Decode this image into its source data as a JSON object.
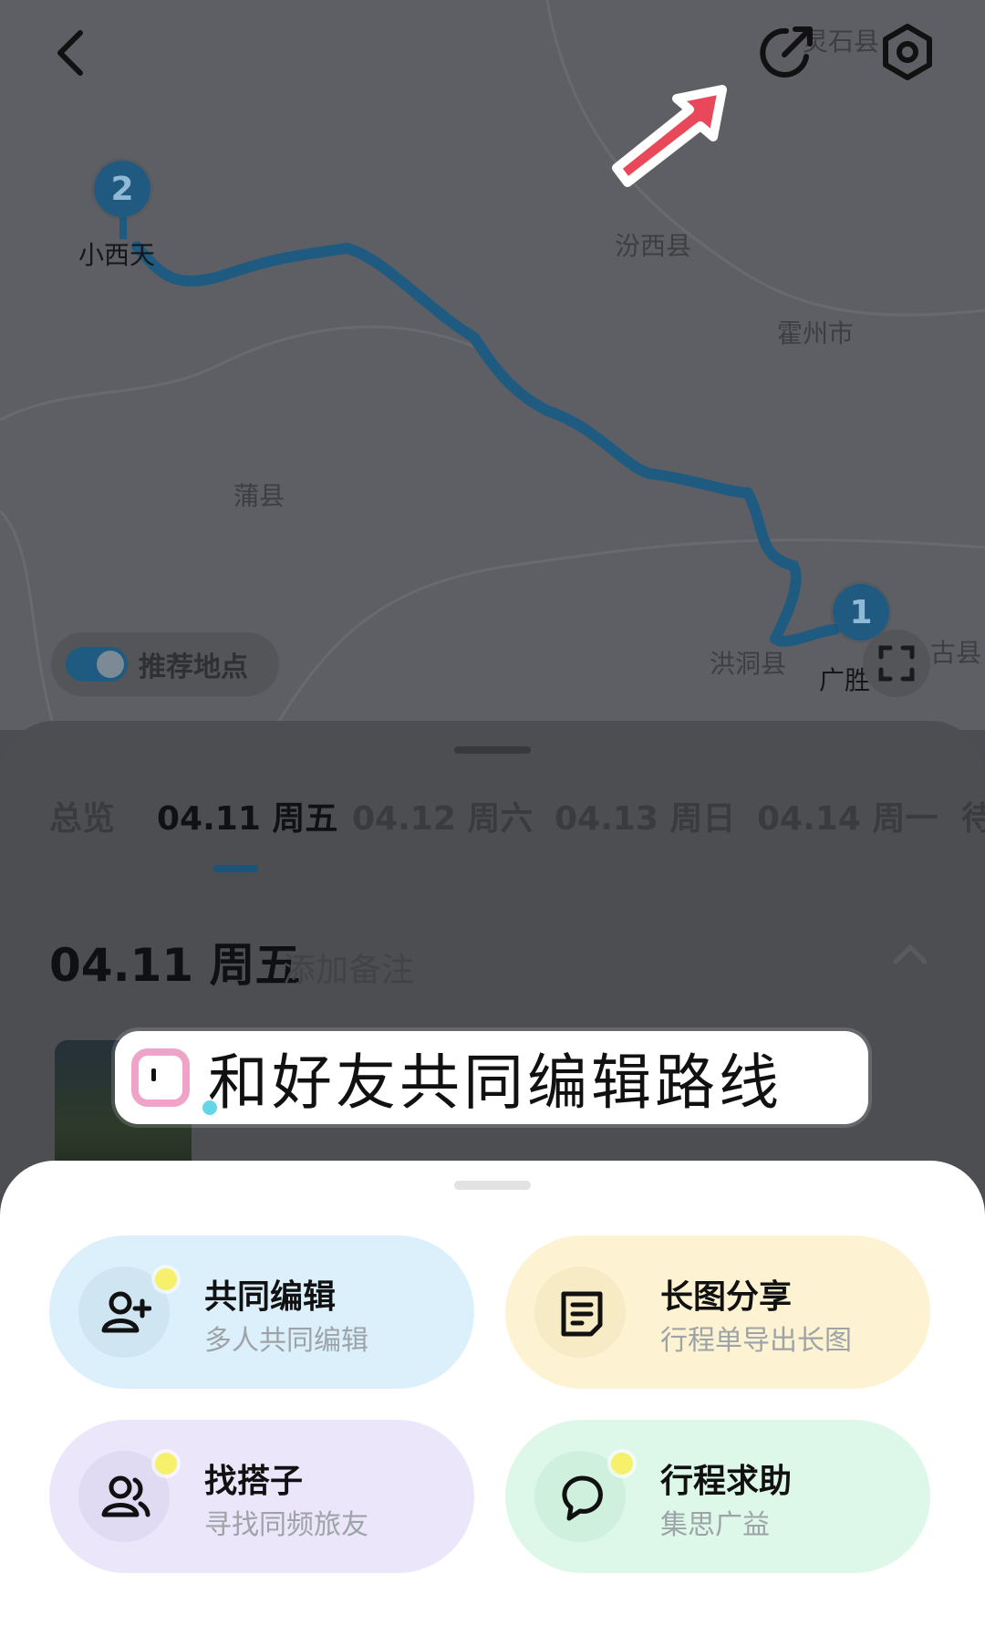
{
  "map": {
    "places": {
      "xiaoxitian": "小西天",
      "fenxi": "汾西县",
      "huozhou": "霍州市",
      "puxian": "蒲县",
      "hongtong": "洪洞县",
      "lingshi": "灵石县",
      "gu": "古县",
      "guang": "广胜"
    },
    "markers": {
      "start": "1",
      "end": "2"
    },
    "recommend_label": "推荐地点",
    "route_color": "#1f5b81"
  },
  "tabs": [
    {
      "label": "总览"
    },
    {
      "label": "04.11 周五"
    },
    {
      "label": "04.12 周六"
    },
    {
      "label": "04.13 周日"
    },
    {
      "label": "04.14 周一"
    },
    {
      "label": "待"
    }
  ],
  "day": {
    "title": "04.11 周五",
    "add_note": "添加备注"
  },
  "caption": {
    "text": "和好友共同编辑路线"
  },
  "actions": [
    {
      "title": "共同编辑",
      "subtitle": "多人共同编辑",
      "icon": "add-user-icon",
      "bg": "#dbf0fb"
    },
    {
      "title": "长图分享",
      "subtitle": "行程单导出长图",
      "icon": "document-icon",
      "bg": "#fdf3d2"
    },
    {
      "title": "找搭子",
      "subtitle": "寻找同频旅友",
      "icon": "two-users-icon",
      "bg": "#ebe6fa"
    },
    {
      "title": "行程求助",
      "subtitle": "集思广益",
      "icon": "chat-bubble-icon",
      "bg": "#ddf8e8"
    }
  ],
  "colors": {
    "arrow": "#e8485a",
    "accent": "#1c5478"
  }
}
